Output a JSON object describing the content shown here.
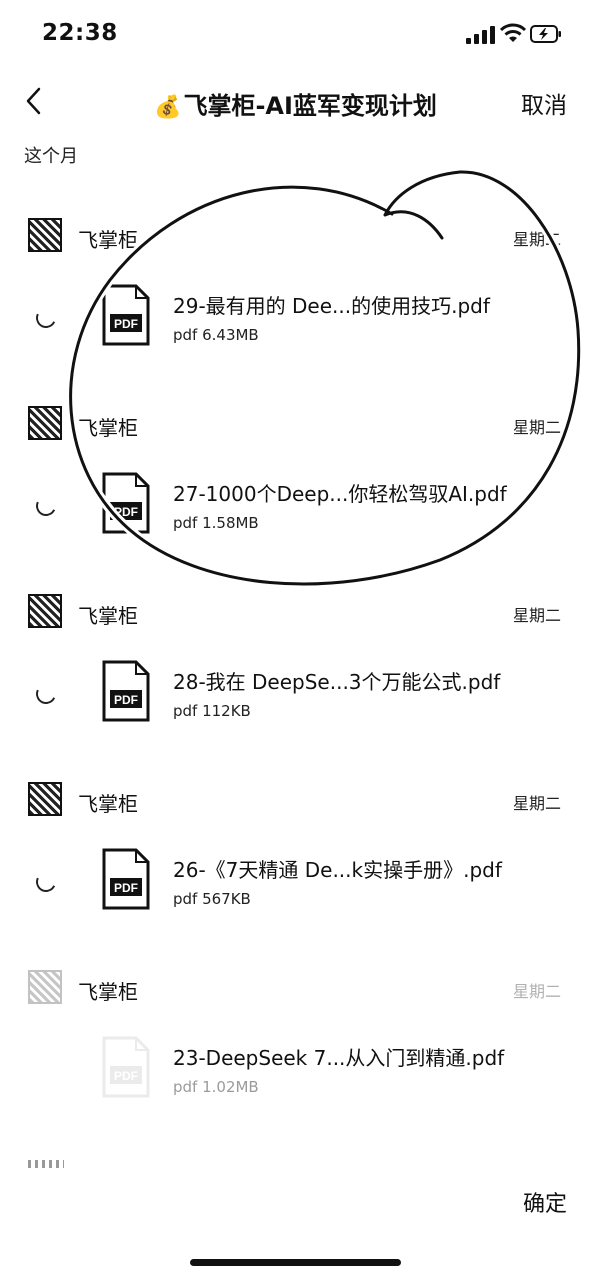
{
  "status_bar": {
    "time": "22:38"
  },
  "header": {
    "title": "飞掌柜-AI蓝军变现计划",
    "cancel_label": "取消",
    "back_icon": "chevron-left-icon",
    "title_icon": "money-bag-icon"
  },
  "section_label": "这个月",
  "messages": [
    {
      "sender": "飞掌柜",
      "day": "星期二",
      "file_name": "29-最有用的 Dee...的使用技巧.pdf",
      "file_size": "pdf 6.43MB"
    },
    {
      "sender": "飞掌柜",
      "day": "星期二",
      "file_name": "27-1000个Deep...你轻松驾驭AI.pdf",
      "file_size": "pdf 1.58MB"
    },
    {
      "sender": "飞掌柜",
      "day": "星期二",
      "file_name": "28-我在 DeepSe...3个万能公式.pdf",
      "file_size": "pdf 112KB"
    },
    {
      "sender": "飞掌柜",
      "day": "星期二",
      "file_name": "26-《7天精通 De...k实操手册》.pdf",
      "file_size": "pdf 567KB"
    },
    {
      "sender": "飞掌柜",
      "day": "星期二",
      "file_name": "23-DeepSeek 7...从入门到精通.pdf",
      "file_size": "pdf 1.02MB"
    }
  ],
  "footer": {
    "confirm_label": "确定"
  },
  "colors": {
    "text": "#111111",
    "background": "#ffffff"
  }
}
